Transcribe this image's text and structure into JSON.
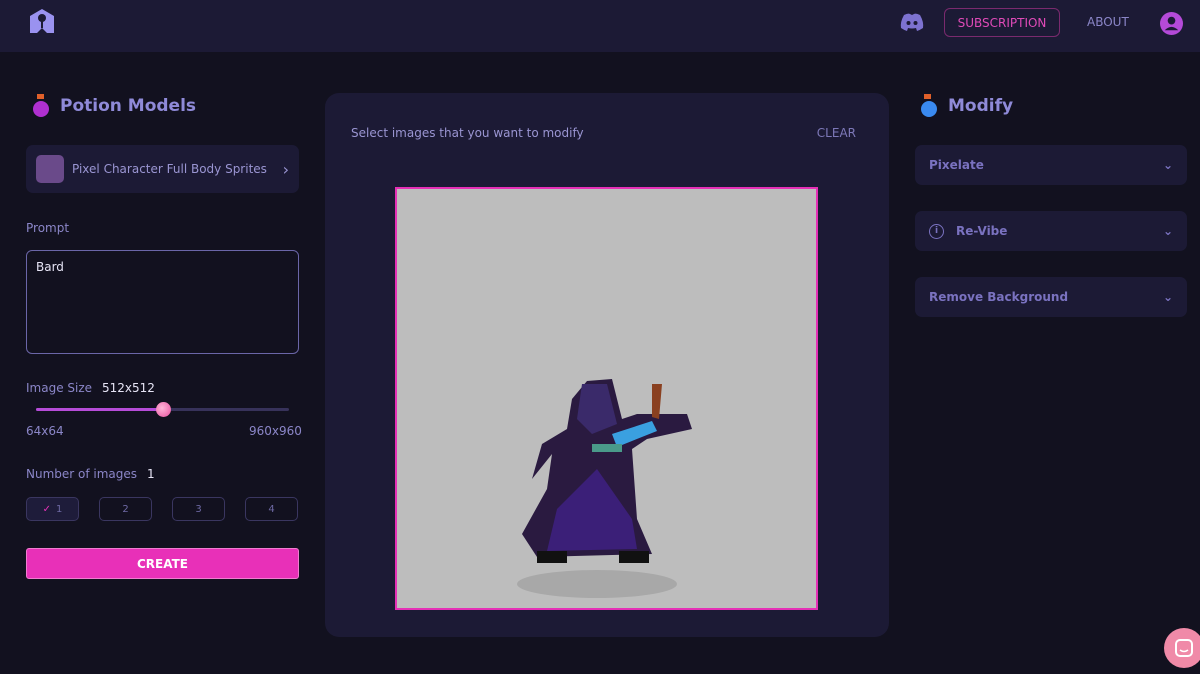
{
  "header": {
    "subscription": "SUBSCRIPTION",
    "about": "ABOUT"
  },
  "left": {
    "title": "Potion Models",
    "model": "Pixel Character Full Body Sprites",
    "prompt_label": "Prompt",
    "prompt_value": "Bard",
    "size_label": "Image Size",
    "size_value": "512x512",
    "size_min": "64x64",
    "size_max": "960x960",
    "size_fraction": 0.5,
    "count_label": "Number of images",
    "count_value": "1",
    "counts": [
      "1",
      "2",
      "3",
      "4"
    ],
    "create": "CREATE"
  },
  "center": {
    "instruction": "Select images that you want to modify",
    "clear": "CLEAR"
  },
  "right": {
    "title": "Modify",
    "options": [
      "Pixelate",
      "Re-Vibe",
      "Remove Background"
    ]
  },
  "colors": {
    "accent": "#e830b8",
    "bg": "#12111f",
    "panel": "#1c1a35"
  }
}
